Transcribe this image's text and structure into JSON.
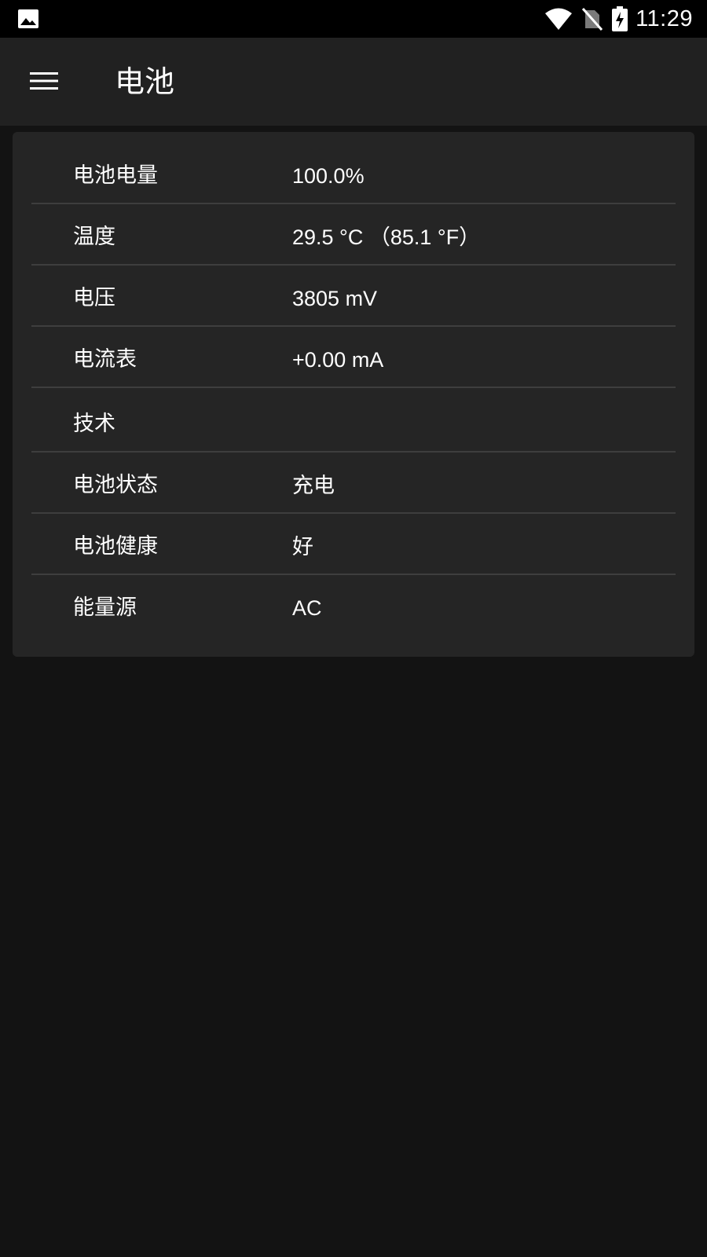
{
  "status_bar": {
    "time": "11:29",
    "icons": [
      "image-icon",
      "wifi-icon",
      "no-sim-icon",
      "battery-charging-icon"
    ]
  },
  "app_bar": {
    "title": "电池",
    "menu_icon": "hamburger-menu-icon"
  },
  "battery_info": {
    "rows": [
      {
        "label": "电池电量",
        "value": "100.0%"
      },
      {
        "label": "温度",
        "value": "29.5 °C （85.1 °F）"
      },
      {
        "label": "电压",
        "value": "3805 mV"
      },
      {
        "label": "电流表",
        "value": "+0.00 mA"
      },
      {
        "label": "技术",
        "value": ""
      },
      {
        "label": "电池状态",
        "value": "充电"
      },
      {
        "label": "电池健康",
        "value": "好"
      },
      {
        "label": "能量源",
        "value": "AC"
      }
    ]
  },
  "colors": {
    "status_bar_bg": "#000000",
    "app_bar_bg": "#212121",
    "page_bg": "#131313",
    "card_bg": "#252525",
    "divider": "#3e3e3e",
    "text": "#ffffff"
  }
}
